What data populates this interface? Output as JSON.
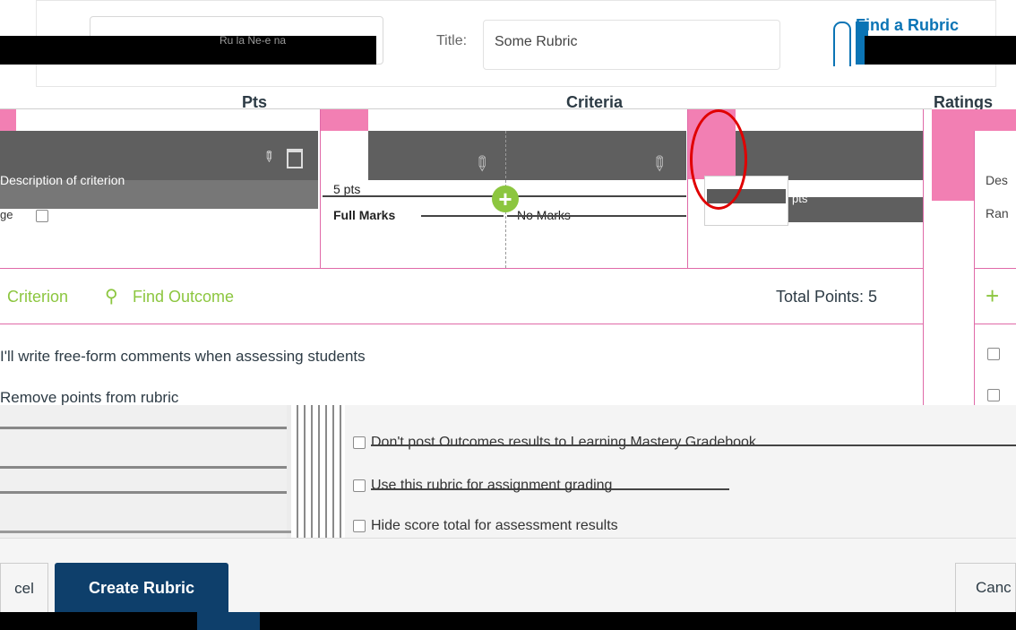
{
  "header": {
    "search_fragment": "Ru la Ne-e na",
    "title_label": "Title:",
    "title_value": "Some Rubric",
    "find_rubric": "Find a Rubric"
  },
  "table": {
    "col_pts": "Pts",
    "col_criteria": "Criteria",
    "col_ratings": "Ratings"
  },
  "criterion": {
    "description": "Description of criterion",
    "range_fragment": "ge"
  },
  "ratings": [
    {
      "points": "5 pts",
      "label": "Full Marks"
    },
    {
      "points": "0 pts",
      "label": "No Marks"
    }
  ],
  "pts_suffix": "pts",
  "right_column": {
    "desc_fragment": "Des",
    "range_fragment": "Ran"
  },
  "actions": {
    "add_criterion": "Criterion",
    "find_outcome": "Find Outcome",
    "total_points": "Total Points: 5"
  },
  "options": {
    "free_form": "I'll write free-form comments when assessing students",
    "remove_points": "Remove points from rubric",
    "dont_post": "Don't post Outcomes results to Learning Mastery Gradebook",
    "use_rubric": "Use this rubric for assignment grading",
    "hide_score": "Hide score total for assessment results"
  },
  "footer": {
    "cancel_fragment": "cel",
    "create_rubric": "Create Rubric",
    "cancel_right_fragment": "Canc"
  },
  "colors": {
    "accent_green": "#8cc63f",
    "primary_button": "#0e3f6b",
    "highlight": "#f27fb3",
    "annotation_red": "#e00000"
  }
}
